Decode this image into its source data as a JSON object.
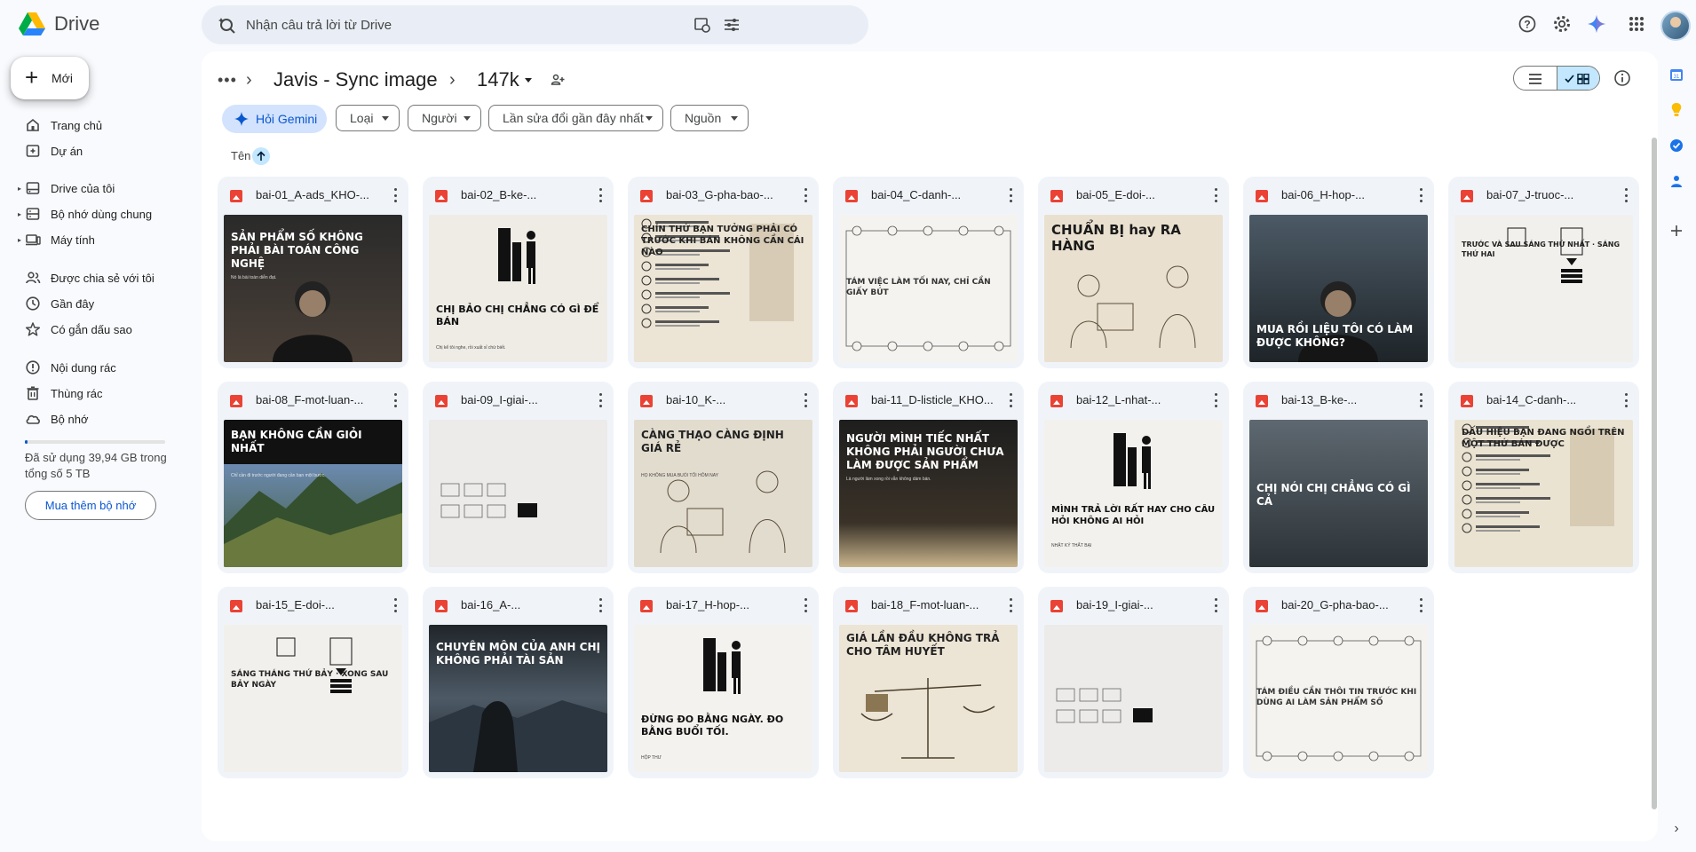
{
  "app": {
    "name": "Drive"
  },
  "search": {
    "placeholder": "Nhận câu trả lời từ Drive"
  },
  "sidebar": {
    "new_label": "Mới",
    "items": [
      {
        "label": "Trang chủ",
        "icon": "home-icon"
      },
      {
        "label": "Dự án",
        "icon": "project-icon"
      },
      {
        "label": "Drive của tôi",
        "icon": "my-drive-icon"
      },
      {
        "label": "Bộ nhớ dùng chung",
        "icon": "shared-drives-icon"
      },
      {
        "label": "Máy tính",
        "icon": "computer-icon"
      },
      {
        "label": "Được chia sẻ với tôi",
        "icon": "shared-with-me-icon"
      },
      {
        "label": "Gần đây",
        "icon": "recent-icon"
      },
      {
        "label": "Có gắn dấu sao",
        "icon": "star-icon"
      },
      {
        "label": "Nội dung rác",
        "icon": "spam-icon"
      },
      {
        "label": "Thùng rác",
        "icon": "trash-icon"
      },
      {
        "label": "Bộ nhớ",
        "icon": "storage-icon"
      }
    ],
    "storage_text": "Đã sử dụng 39,94 GB trong tổng số 5 TB",
    "storage_fraction": 0.008,
    "buy_storage_label": "Mua thêm bộ nhớ"
  },
  "breadcrumb": {
    "parent": "Javis - Sync image",
    "current": "147k"
  },
  "filters": {
    "gemini": "Hỏi Gemini",
    "chips": [
      "Loại",
      "Người",
      "Lần sửa đổi gần đây nhất",
      "Nguồn"
    ]
  },
  "sort": {
    "label": "Tên"
  },
  "files": [
    {
      "name": "bai-01_A-ads_KHO-...",
      "title": "SẢN PHẨM SỐ KHÔNG PHẢI BÀI TOÁN CÔNG NGHỆ",
      "subtitle": "Nó là bài toán diễn đạt."
    },
    {
      "name": "bai-02_B-ke-...",
      "title": "CHỊ BẢO CHỊ CHẲNG CÓ GÌ ĐỂ BÁN",
      "subtitle": "Chị kể tôi nghe, rồi xuất xỉ chừ biết."
    },
    {
      "name": "bai-03_G-pha-bao-...",
      "title": "CHÍN THỨ BẠN TƯỞNG PHẢI CÓ TRƯỚC KHI BÁN KHÔNG CẦN CÁI NÀO",
      "subtitle": ""
    },
    {
      "name": "bai-04_C-danh-...",
      "title": "TÁM VIỆC LÀM TỐI NAY, CHỈ CẦN GIẤY BÚT",
      "subtitle": ""
    },
    {
      "name": "bai-05_E-doi-...",
      "title": "CHUẨN BỊ hay RA HÀNG",
      "subtitle": ""
    },
    {
      "name": "bai-06_H-hop-...",
      "title": "MUA RỒI LIỆU TÔI CÓ LÀM ĐƯỢC KHÔNG?",
      "subtitle": ""
    },
    {
      "name": "bai-07_J-truoc-...",
      "title": "TRƯỚC VÀ SAU SÁNG THỨ NHẤT · SÁNG THỨ HAI",
      "subtitle": ""
    },
    {
      "name": "bai-08_F-mot-luan-...",
      "title": "BẠN KHÔNG CẦN GIỎI NHẤT",
      "subtitle": "Chỉ cần đi trước người đang cần bạn một bước."
    },
    {
      "name": "bai-09_I-giai-...",
      "title": "",
      "subtitle": ""
    },
    {
      "name": "bai-10_K-...",
      "title": "CÀNG THẠO CÀNG ĐỊNH GIÁ RẺ",
      "subtitle": "HỌ KHÔNG MUA BUỔI TỐI HÔM NAY"
    },
    {
      "name": "bai-11_D-listicle_KHO...",
      "title": "NGƯỜI MÌNH TIẾC NHẤT KHÔNG PHẢI NGƯỜI CHƯA LÀM ĐƯỢC SẢN PHẨM",
      "subtitle": "Là người làm xong rồi vẫn không dám bán."
    },
    {
      "name": "bai-12_L-nhat-...",
      "title": "MÌNH TRẢ LỜI RẤT HAY CHO CÂU HỎI KHÔNG AI HỎI",
      "subtitle": "NHẬT KÝ THẤT BẠI"
    },
    {
      "name": "bai-13_B-ke-...",
      "title": "CHỊ NÓI CHỊ CHẲNG CÓ GÌ CẢ",
      "subtitle": ""
    },
    {
      "name": "bai-14_C-danh-...",
      "title": "DẤU HIỆU BẠN ĐANG NGỒI TRÊN MỘT THỨ BÁN ĐƯỢC",
      "subtitle": ""
    },
    {
      "name": "bai-15_E-doi-...",
      "title": "SÁNG THÁNG THỨ BẢY · XONG SAU BẢY NGÀY",
      "subtitle": ""
    },
    {
      "name": "bai-16_A-...",
      "title": "CHUYÊN MÔN CỦA ANH CHỊ KHÔNG PHẢI TÀI SẢN",
      "subtitle": ""
    },
    {
      "name": "bai-17_H-hop-...",
      "title": "ĐỪNG ĐO BẰNG NGÀY. ĐO BẰNG BUỔI TỐI.",
      "subtitle": "HỘP THƯ"
    },
    {
      "name": "bai-18_F-mot-luan-...",
      "title": "GIÁ LẦN ĐẦU KHÔNG TRẢ CHO TÂM HUYẾT",
      "subtitle": ""
    },
    {
      "name": "bai-19_I-giai-...",
      "title": "",
      "subtitle": ""
    },
    {
      "name": "bai-20_G-pha-bao-...",
      "title": "TÁM ĐIỀU CẦN THÔI TIN TRƯỚC KHI DÙNG AI LÀM SẢN PHẨM SỐ",
      "subtitle": ""
    }
  ]
}
